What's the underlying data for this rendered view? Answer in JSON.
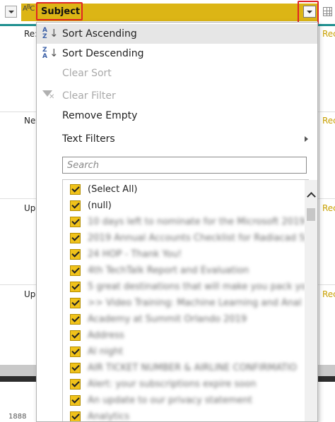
{
  "header": {
    "column_type_icon": "abc-type-icon",
    "column_title": "Subject",
    "filter_icon": "chevron-down-icon"
  },
  "rows": [
    {
      "left": "Re:",
      "right": "Rec"
    },
    {
      "left": "Nev",
      "right": "Rec"
    },
    {
      "left": "Upc",
      "right": "Rec"
    },
    {
      "left": "Upc",
      "right": "Rec"
    }
  ],
  "bottom_value": "1888",
  "menu": {
    "sort_ascending": {
      "label": "Sort Ascending",
      "icon_top": "A",
      "icon_bottom": "Z"
    },
    "sort_descending": {
      "label": "Sort Descending",
      "icon_top": "Z",
      "icon_bottom": "A"
    },
    "clear_sort": "Clear Sort",
    "clear_filter": "Clear Filter",
    "remove_empty": "Remove Empty",
    "text_filters": "Text Filters",
    "search_placeholder": "Search",
    "items": [
      "(Select All)",
      "(null)",
      "10 days left to nominate for the Microsoft 2019",
      "2019 Annual Accounts Checklist for Radiacad Sy",
      "24 HOP - Thank You!",
      "4th TechTalk Report and Evaluation",
      "5 great destinations that will make you pack yo",
      ">> Video Training: Machine Learning and Anal",
      "Academy at Summit Orlando 2019",
      "Address",
      "Al night",
      "AIR TICKET NUMBER & AIRLINE CONFIRMATIO",
      "Alert: your subscriptions expire soon",
      "An update to our privacy statement",
      "Analytics"
    ]
  },
  "colors": {
    "header_accent": "#dcb515",
    "highlight_box": "#e02424",
    "checkbox": "#f0c21a",
    "teal_line": "#1e8f8f"
  }
}
